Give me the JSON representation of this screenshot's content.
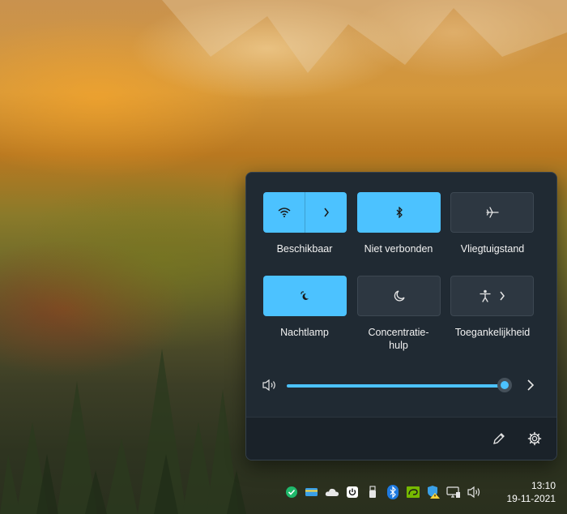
{
  "quick_settings": {
    "wifi": {
      "label": "Beschikbaar",
      "icon": "wifi-icon",
      "state": "on"
    },
    "bluetooth": {
      "label": "Niet verbonden",
      "icon": "bluetooth-icon",
      "state": "on"
    },
    "airplane": {
      "label": "Vliegtuigstand",
      "icon": "airplane-icon",
      "state": "off"
    },
    "nightlight": {
      "label": "Nachtlamp",
      "icon": "night-light-icon",
      "state": "on"
    },
    "focus": {
      "label_line1": "Concentratie-",
      "label_line2": "hulp",
      "icon": "moon-icon",
      "state": "off"
    },
    "accessibility": {
      "label": "Toegankelijkheid",
      "icon": "accessibility-icon",
      "state": "off"
    },
    "volume": {
      "level": 0.97,
      "icon": "speaker-icon"
    },
    "footer": {
      "edit_icon": "pencil-icon",
      "settings_icon": "gear-icon"
    }
  },
  "taskbar": {
    "time": "13:10",
    "date": "19-11-2021",
    "tray_icons": [
      "defender-check-icon",
      "card-icon",
      "onedrive-cloud-icon",
      "power-icon",
      "usb-icon",
      "bluetooth-tray-icon",
      "nvidia-icon",
      "security-warning-icon",
      "network-icon",
      "volume-tray-icon"
    ]
  },
  "colors": {
    "accent": "#4cc2ff",
    "panel": "#202a33",
    "tile_off": "#2d3741"
  }
}
